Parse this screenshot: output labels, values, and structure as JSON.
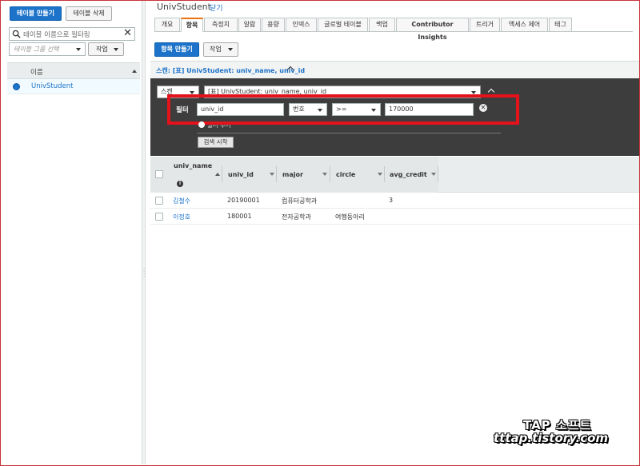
{
  "left_panel": {
    "create_table_label": "테이블 만들기",
    "delete_table_label": "테이블 삭제",
    "search_placeholder": "테이블 이름으로 필터링",
    "group_select_placeholder": "테이블 그룹 선택",
    "action_label": "작업",
    "column_header": "이름",
    "tables": [
      {
        "name": "UnivStudent",
        "selected": true
      }
    ]
  },
  "main": {
    "title": "UnivStudent",
    "close_label": "닫기",
    "tabs": [
      {
        "label": "개요"
      },
      {
        "label": "항목",
        "active": true
      },
      {
        "label": "측정치"
      },
      {
        "label": "알람"
      },
      {
        "label": "용량"
      },
      {
        "label": "인덱스"
      },
      {
        "label": "글로벌 테이블"
      },
      {
        "label": "백업"
      },
      {
        "label": "Contributor Insights"
      },
      {
        "label": "트리거"
      },
      {
        "label": "액세스 제어"
      },
      {
        "label": "태그"
      }
    ],
    "create_item_label": "항목 만들기",
    "action_label": "작업",
    "scan_title": "스캔: [표] UnivStudent: univ_name, univ_id",
    "scan_mode_value": "스캔",
    "scan_target_value": "[표] UnivStudent: univ_name, univ_id",
    "filter": {
      "label": "필터",
      "attribute": "univ_id",
      "type": "번호",
      "operator": ">=",
      "value": "170000",
      "add_filter_label": "필터 추가"
    },
    "search_start_label": "검색 시작",
    "results": {
      "columns": [
        "univ_name",
        "univ_id",
        "major",
        "circle",
        "avg_credit"
      ],
      "rows": [
        {
          "univ_name": "김철수",
          "univ_id": "20190001",
          "major": "컴퓨터공학과",
          "circle": "",
          "avg_credit": "3"
        },
        {
          "univ_name": "이정호",
          "univ_id": "180001",
          "major": "전자공학과",
          "circle": "여행동아리",
          "avg_credit": ""
        }
      ]
    }
  },
  "watermark": {
    "line1": "TAP 소프트",
    "line2": "tttap.tistory.com"
  },
  "colors": {
    "accent_blue": "#1c73c9",
    "active_tab_orange": "#ec7211",
    "highlight_red": "#e3121b",
    "dark_panel": "#3d3d3d"
  }
}
